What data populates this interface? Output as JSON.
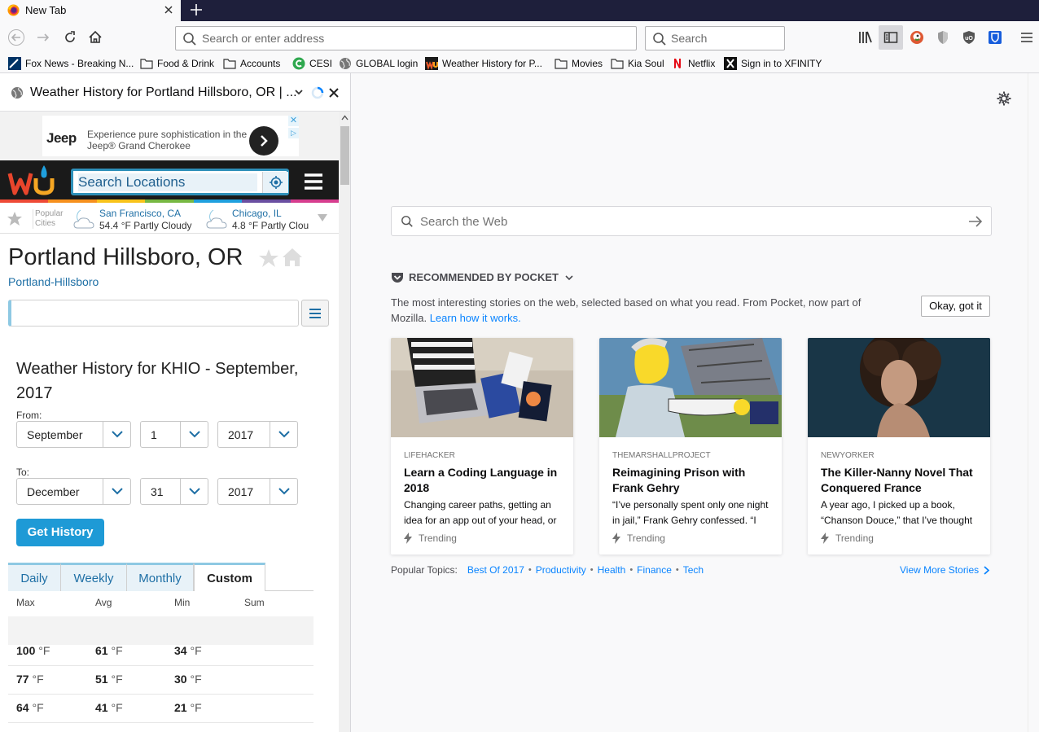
{
  "browser": {
    "tab_title": "New Tab",
    "url_placeholder": "Search or enter address",
    "search_placeholder": "Search",
    "bookmarks": [
      "Fox News - Breaking N...",
      "Food & Drink",
      "Accounts",
      "CESI",
      "GLOBAL login",
      "Weather History for P...",
      "Movies",
      "Kia Soul",
      "Netflix",
      "Sign in to XFINITY"
    ]
  },
  "sidebar": {
    "title": "Weather History for Portland Hillsboro, OR | ..."
  },
  "ad": {
    "brand": "Jeep",
    "text": "Experience pure sophistication in the Jeep® Grand Cherokee",
    "close": "✕",
    "choices": "▷"
  },
  "wu": {
    "search_placeholder": "Search Locations",
    "popular_label": "Popular Cities",
    "cities": [
      {
        "name": "San Francisco, CA",
        "cond": "54.4 °F Partly Cloudy"
      },
      {
        "name": "Chicago, IL",
        "cond": "4.8 °F Partly Clou"
      }
    ],
    "location_title": "Portland Hillsboro, OR",
    "location_sub": "Portland-Hillsboro",
    "history_title": "Weather History for KHIO - September, 2017",
    "from_label": "From:",
    "to_label": "To:",
    "from": {
      "month": "September",
      "day": "1",
      "year": "2017"
    },
    "to": {
      "month": "December",
      "day": "31",
      "year": "2017"
    },
    "get_history": "Get History",
    "tabs": [
      "Daily",
      "Weekly",
      "Monthly",
      "Custom"
    ],
    "active_tab": "Custom",
    "columns": [
      "Max",
      "Avg",
      "Min",
      "Sum"
    ],
    "rows": [
      {
        "max": "100",
        "avg": "61",
        "min": "34"
      },
      {
        "max": "77",
        "avg": "51",
        "min": "30"
      },
      {
        "max": "64",
        "avg": "41",
        "min": "21"
      }
    ],
    "unit": "°F"
  },
  "newtab": {
    "search_placeholder": "Search the Web",
    "pocket_heading": "RECOMMENDED BY POCKET",
    "pocket_desc": "The most interesting stories on the web, selected based on what you read. From Pocket, now part of Mozilla.",
    "pocket_link": "Learn how it works.",
    "ok_button": "Okay, got it",
    "cards": [
      {
        "source": "LIFEHACKER",
        "title": "Learn a Coding Language in 2018",
        "excerpt": "Changing career paths, getting an idea for an app out of your head, or",
        "tag": "Trending"
      },
      {
        "source": "THEMARSHALLPROJECT",
        "title": "Reimagining Prison with Frank Gehry",
        "excerpt": "“I’ve personally spent only one night in jail,” Frank Gehry confessed. “I",
        "tag": "Trending"
      },
      {
        "source": "NEWYORKER",
        "title": "The Killer-Nanny Novel That Conquered France",
        "excerpt": "A year ago, I picked up a book, “Chanson Douce,” that I’ve thought",
        "tag": "Trending"
      }
    ],
    "topics_label": "Popular Topics:",
    "topics": [
      "Best Of 2017",
      "Productivity",
      "Health",
      "Finance",
      "Tech"
    ],
    "view_more": "View More Stories"
  }
}
